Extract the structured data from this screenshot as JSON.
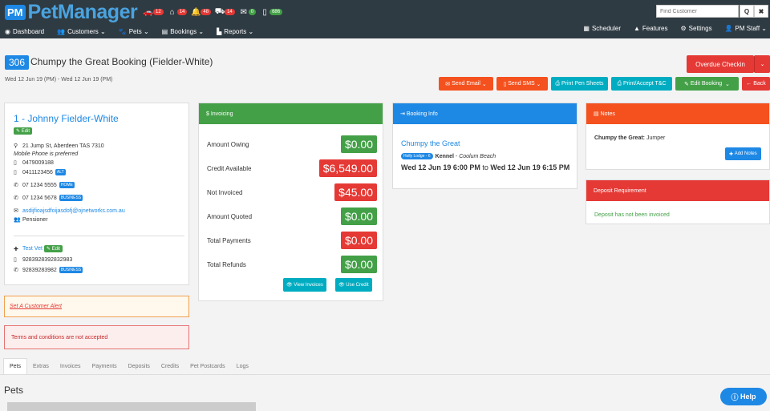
{
  "app": {
    "logo_badge": "PM",
    "logo_text": "PetManager"
  },
  "top_icons": [
    {
      "icon": "car-icon",
      "count": "12"
    },
    {
      "icon": "home-icon",
      "count": "14"
    },
    {
      "icon": "bell-icon",
      "count": "48"
    },
    {
      "icon": "truck-icon",
      "count": "14"
    },
    {
      "icon": "chat-icon",
      "count": "0"
    },
    {
      "icon": "phone-icon",
      "count": "686"
    }
  ],
  "search": {
    "placeholder": "Find Customer",
    "search_icon": "Q",
    "close_icon": "✖"
  },
  "nav": {
    "dashboard": "Dashboard",
    "customers": "Customers",
    "pets": "Pets",
    "bookings": "Bookings",
    "reports": "Reports",
    "scheduler": "Scheduler",
    "features": "Features",
    "settings": "Settings",
    "staff": "PM Staff"
  },
  "booking": {
    "number": "306",
    "title": "Chumpy the Great Booking (Fielder-White)",
    "dates": "Wed 12 Jun 19 (PM) - Wed 12 Jun 19 (PM)"
  },
  "actions": {
    "overdue_checkin": "Overdue Checkin",
    "send_email": "Send Email",
    "send_sms": "Send SMS",
    "print_pen_sheets": "Print Pen Sheets",
    "print_accept_tc": "Print/Accept T&C",
    "edit_booking": "Edit Booking",
    "back": "Back"
  },
  "customer": {
    "name": "1 - Johnny Fielder-White",
    "edit": "Edit",
    "address": "21 Jump St, Aberdeen TAS 7310",
    "mobile_note": "Mobile Phone is preferred",
    "phone1": "0479009188",
    "phone2": "0411123456",
    "phone2_tag": "ALT",
    "phone3": "07 1234 5555",
    "phone3_tag": "HOME",
    "phone4": "07 1234 5678",
    "phone4_tag": "BUSINESS",
    "email": "asdijfioajsdfoijasdofj@ojnetworks.com.au",
    "group": "Pensioner",
    "vet_name": "Test Vet",
    "vet_edit": "Edit",
    "vet_phone1": "9283928392832983",
    "vet_phone2": "92839283982",
    "vet_phone2_tag": "BUSINESS"
  },
  "alerts": {
    "customer_alert": "Set A Customer Alert",
    "terms": "Terms and conditions are not accepted"
  },
  "invoicing": {
    "header": "Invoicing",
    "rows": [
      {
        "label": "Amount Owing",
        "value": "$0.00",
        "status": "green"
      },
      {
        "label": "Credit Available",
        "value": "$6,549.00",
        "status": "red"
      },
      {
        "label": "Not Invoiced",
        "value": "$45.00",
        "status": "red"
      },
      {
        "label": "Amount Quoted",
        "value": "$0.00",
        "status": "green"
      },
      {
        "label": "Total Payments",
        "value": "$0.00",
        "status": "red"
      },
      {
        "label": "Total Refunds",
        "value": "$0.00",
        "status": "green"
      }
    ],
    "view_invoices": "View Invoices",
    "use_credit": "Use Credit"
  },
  "booking_info": {
    "header": "Booking Info",
    "pet_name": "Chumpy the Great",
    "location_badge": "Holly Lodge - 6",
    "kennel": "Kennel",
    "site": "Coolum Beach",
    "time_from": "Wed 12 Jun 19 6:00 PM",
    "to": "to",
    "time_to": "Wed 12 Jun 19 6:15 PM"
  },
  "notes": {
    "header": "Notes",
    "pet_label": "Chumpy the Great:",
    "pet_note": "Jumper",
    "add_notes": "Add Notes"
  },
  "deposit": {
    "header": "Deposit Requirement",
    "message": "Deposit has not been invoiced"
  },
  "tabs": [
    "Pets",
    "Extras",
    "Invoices",
    "Payments",
    "Deposits",
    "Credits",
    "Pet Postcards",
    "Logs"
  ],
  "pets_heading": "Pets",
  "help": "Help",
  "colors": {
    "topbar": "#2f3b43",
    "blue": "#1e88e5",
    "green": "#43a047",
    "red": "#e53935",
    "orange": "#f4511e",
    "cyan": "#00acc1"
  }
}
